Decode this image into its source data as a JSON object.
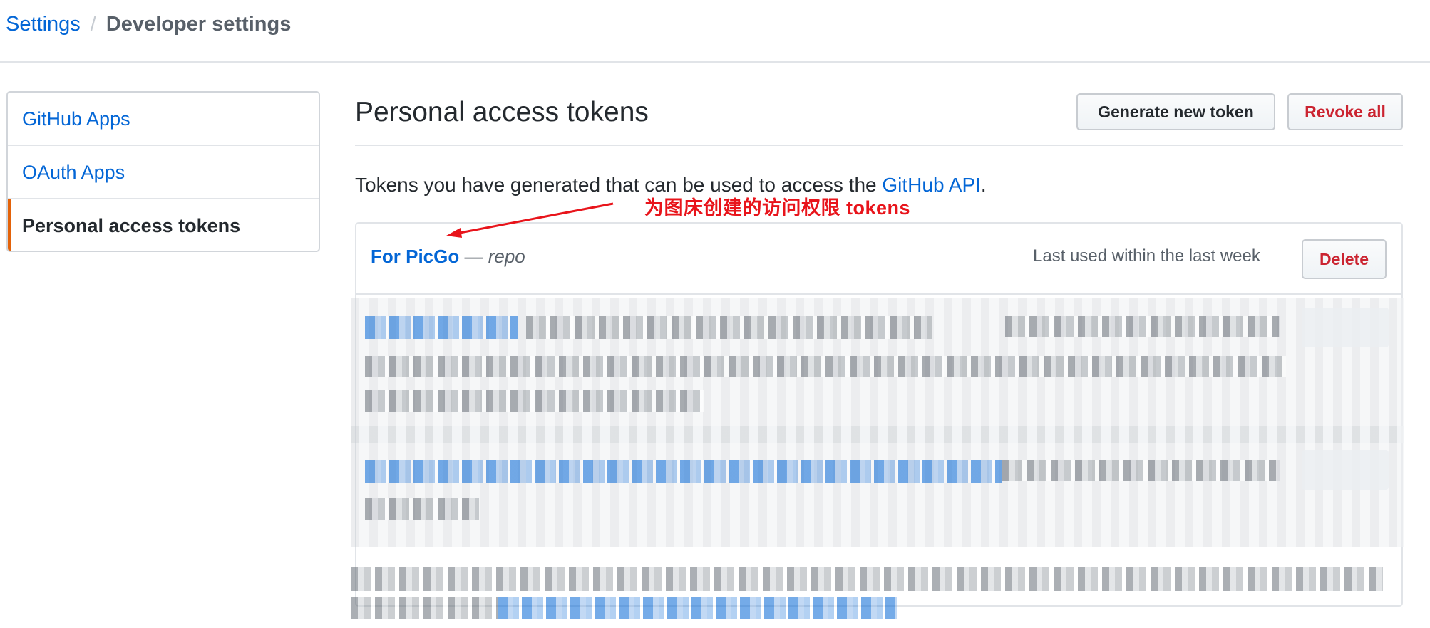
{
  "breadcrumb": {
    "root": "Settings",
    "separator": "/",
    "current": "Developer settings"
  },
  "sidebar": {
    "items": [
      {
        "label": "GitHub Apps",
        "active": false
      },
      {
        "label": "OAuth Apps",
        "active": false
      },
      {
        "label": "Personal access tokens",
        "active": true
      }
    ]
  },
  "main": {
    "title": "Personal access tokens",
    "generate_button": "Generate new token",
    "revoke_button": "Revoke all",
    "intro_text": "Tokens you have generated that can be used to access the ",
    "intro_link": "GitHub API",
    "intro_end": "."
  },
  "annotation": {
    "text": "为图床创建的访问权限 tokens",
    "color": "#e8141b"
  },
  "tokens": [
    {
      "name": "For PicGo",
      "separator": " — ",
      "scope": "repo",
      "last_used": "Last used within the last week",
      "delete_label": "Delete"
    }
  ],
  "colors": {
    "link": "#0366d6",
    "danger": "#cb2431",
    "active_accent": "#e36209",
    "muted": "#586069"
  }
}
